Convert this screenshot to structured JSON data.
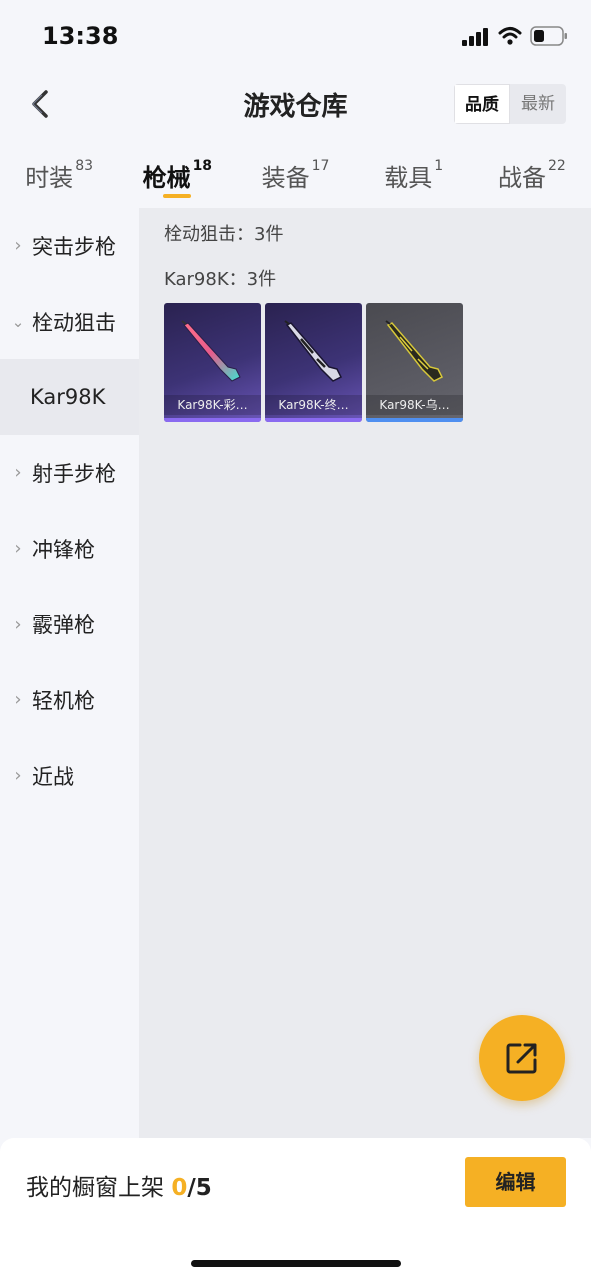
{
  "status_bar": {
    "time": "13:38",
    "icons": [
      "signal-icon",
      "wifi-icon",
      "battery-icon"
    ]
  },
  "header": {
    "title": "游戏仓库",
    "back_icon": "chevron-left-icon",
    "sort_options": [
      {
        "label": "品质",
        "active": true
      },
      {
        "label": "最新",
        "active": false
      }
    ]
  },
  "tabs": [
    {
      "label": "时装",
      "count": "83",
      "active": false
    },
    {
      "label": "枪械",
      "count": "18",
      "active": true
    },
    {
      "label": "装备",
      "count": "17",
      "active": false
    },
    {
      "label": "载具",
      "count": "1",
      "active": false
    },
    {
      "label": "战备",
      "count": "22",
      "active": false
    }
  ],
  "sidebar": {
    "items": [
      {
        "label": "突击步枪",
        "expanded": false
      },
      {
        "label": "栓动狙击",
        "expanded": true,
        "children": [
          "Kar98K"
        ]
      },
      {
        "label": "射手步枪",
        "expanded": false
      },
      {
        "label": "冲锋枪",
        "expanded": false
      },
      {
        "label": "霰弹枪",
        "expanded": false
      },
      {
        "label": "轻机枪",
        "expanded": false
      },
      {
        "label": "近战",
        "expanded": false
      }
    ],
    "selected_child": "Kar98K"
  },
  "content": {
    "section_title": "栓动狙击：3件",
    "group_title": "Kar98K：3件",
    "items": [
      {
        "name": "Kar98K-彩…",
        "rarity_color": "#8a6af0",
        "style": "purple"
      },
      {
        "name": "Kar98K-终…",
        "rarity_color": "#8a6af0",
        "style": "purple"
      },
      {
        "name": "Kar98K-乌…",
        "rarity_color": "#4f8ff0",
        "style": "grey"
      }
    ]
  },
  "fab": {
    "icon": "share-external-icon",
    "color": "#f5b024"
  },
  "bottom_bar": {
    "label": "我的橱窗上架",
    "count_current": "0",
    "count_sep_total": "/5",
    "edit_label": "编辑"
  },
  "colors": {
    "accent": "#f5b024",
    "background": "#f5f6fa",
    "content_bg": "#eaebef"
  }
}
